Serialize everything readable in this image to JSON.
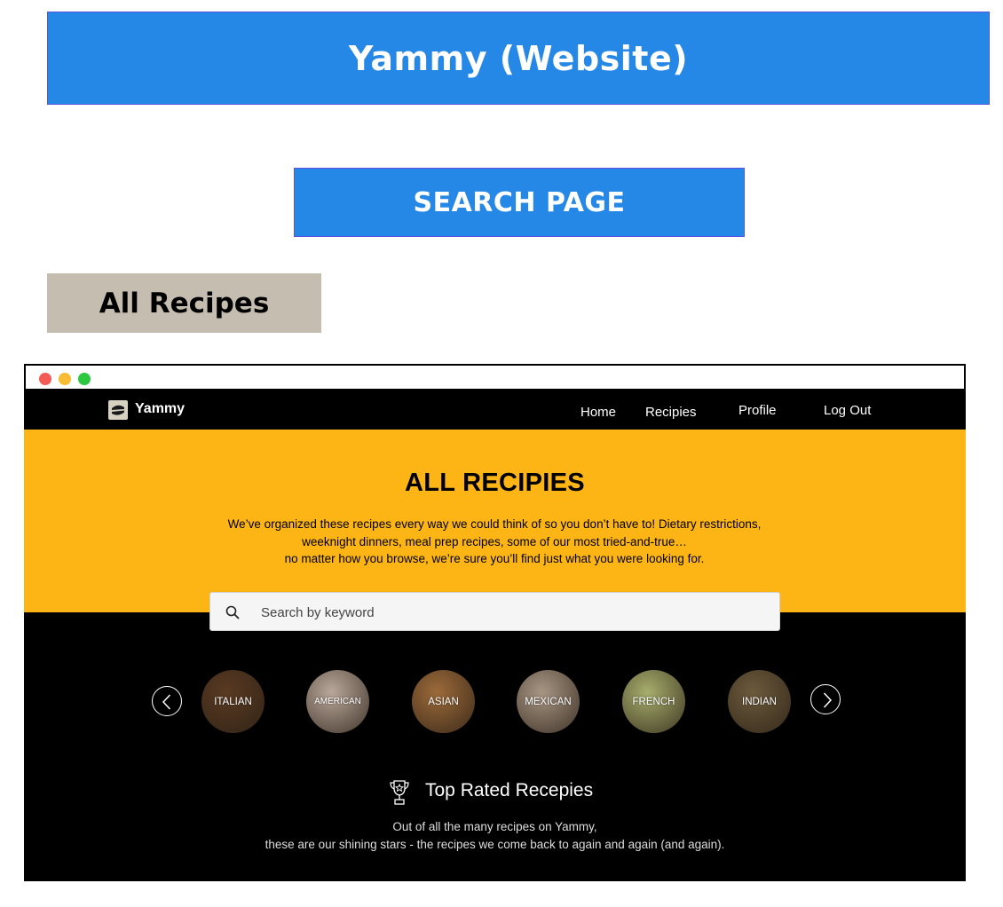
{
  "banner": {
    "title": "Yammy (Website)"
  },
  "section": {
    "label": "SEARCH PAGE"
  },
  "page": {
    "label": "All Recipes"
  },
  "colors": {
    "banner_blue": "#2587e6",
    "hero_yellow": "#fdb515",
    "tag_beige": "#c5bdaf",
    "window_bg": "#000000"
  },
  "window": {
    "controls": [
      "close-dot",
      "minimize-dot",
      "maximize-dot"
    ]
  },
  "nav": {
    "logo_icon": "burger-icon",
    "brand": "Yammy",
    "links": [
      "Home",
      "Recipies",
      "Profile",
      "Log Out"
    ]
  },
  "hero": {
    "title": "ALL RECIPIES",
    "desc_lines": [
      "We’ve organized these recipes every way we could think of so you don’t have to! Dietary restrictions,",
      "weeknight dinners, meal prep recipes, some of our most tried-and-true…",
      "no matter how you browse, we’re sure you’ll find just what you were looking for."
    ]
  },
  "search": {
    "icon": "search-icon",
    "placeholder": "Search by keyword"
  },
  "categories": [
    {
      "label": "ITALIAN",
      "bg": "#5a3a22"
    },
    {
      "label": "AMERICAN",
      "bg": "#b9a79b"
    },
    {
      "label": "ASIAN",
      "bg": "#9c6a3a"
    },
    {
      "label": "MEXICAN",
      "bg": "#a89684"
    },
    {
      "label": "FRENCH",
      "bg": "#a7ae6c"
    },
    {
      "label": "INDIAN",
      "bg": "#6c5a3c"
    }
  ],
  "top_rated": {
    "icon": "trophy-icon",
    "title": "Top Rated Recepies",
    "desc_lines": [
      "Out of all the many recipes on Yammy,",
      "these are our shining stars - the recipes we come back to again and again (and again)."
    ]
  }
}
